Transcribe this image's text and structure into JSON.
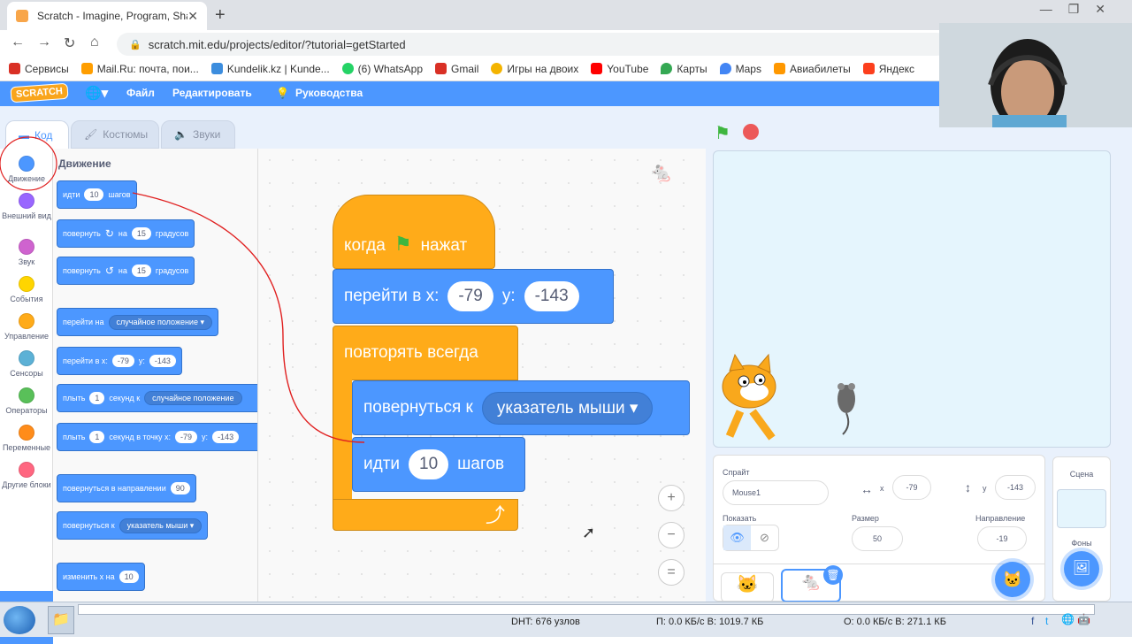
{
  "browser": {
    "tab_title": "Scratch - Imagine, Program, Sha",
    "new_tab": "+",
    "url": "scratch.mit.edu/projects/editor/?tutorial=getStarted",
    "bookmarks": [
      {
        "label": "Сервисы",
        "color": "#d93025"
      },
      {
        "label": "Mail.Ru: почта, пои...",
        "color": "#ff9e00"
      },
      {
        "label": "Kundelik.kz | Kunde...",
        "color": "#3c8dde"
      },
      {
        "label": "(6) WhatsApp",
        "color": "#25d366"
      },
      {
        "label": "Gmail",
        "color": "#d93025"
      },
      {
        "label": "Игры на двоих",
        "color": "#f4b400"
      },
      {
        "label": "YouTube",
        "color": "#ff0000"
      },
      {
        "label": "Карты",
        "color": "#34a853"
      },
      {
        "label": "Maps",
        "color": "#4285f4"
      },
      {
        "label": "Авиабилеты",
        "color": "#ff9800"
      },
      {
        "label": "Яндекс",
        "color": "#fc3f1d"
      }
    ]
  },
  "menu": {
    "logo": "SCRATCH",
    "file": "Файл",
    "edit": "Редактировать",
    "tutorials": "Руководства"
  },
  "editor_tabs": {
    "code": "Код",
    "costumes": "Костюмы",
    "sounds": "Звуки"
  },
  "categories": [
    {
      "label": "Движение",
      "color": "#4c97ff"
    },
    {
      "label": "Внешний вид",
      "color": "#9966ff"
    },
    {
      "label": "Звук",
      "color": "#cf63cf"
    },
    {
      "label": "События",
      "color": "#ffd500"
    },
    {
      "label": "Управление",
      "color": "#ffab19"
    },
    {
      "label": "Сенсоры",
      "color": "#5cb1d6"
    },
    {
      "label": "Операторы",
      "color": "#59c059"
    },
    {
      "label": "Переменные",
      "color": "#ff8c1a"
    },
    {
      "label": "Другие блоки",
      "color": "#ff6680"
    }
  ],
  "palette": {
    "title": "Движение",
    "b1": {
      "a": "идти",
      "v": "10",
      "b": "шагов"
    },
    "b2": {
      "a": "повернуть",
      "b": "на",
      "v": "15",
      "c": "градусов"
    },
    "b3": {
      "a": "повернуть",
      "b": "на",
      "v": "15",
      "c": "градусов"
    },
    "b4": {
      "a": "перейти на",
      "d": "случайное положение"
    },
    "b5": {
      "a": "перейти в x:",
      "v1": "-79",
      "b": "y:",
      "v2": "-143"
    },
    "b6": {
      "a": "плыть",
      "v": "1",
      "b": "секунд к",
      "d": "случайное положение"
    },
    "b7": {
      "a": "плыть",
      "v": "1",
      "b": "секунд в точку x:",
      "v1": "-79",
      "c": "y:",
      "v2": "-143"
    },
    "b8": {
      "a": "повернуться в направлении",
      "v": "90"
    },
    "b9": {
      "a": "повернуться к",
      "d": "указатель мыши"
    },
    "b10": {
      "a": "изменить х на",
      "v": "10"
    }
  },
  "script": {
    "hat_when": "когда",
    "hat_clicked": "нажат",
    "goto_label": "перейти в x:",
    "goto_x": "-79",
    "goto_y_label": "y:",
    "goto_y": "-143",
    "forever": "повторять всегда",
    "point_label": "повернуться к",
    "point_target": "указатель мыши",
    "move_label": "идти",
    "move_steps": "10",
    "move_suffix": "шагов"
  },
  "sprite_info": {
    "sprite_label": "Спрайт",
    "sprite_name": "Mouse1",
    "x_label": "x",
    "x": "-79",
    "y_label": "y",
    "y": "-143",
    "show_label": "Показать",
    "size_label": "Размер",
    "size": "50",
    "direction_label": "Направление",
    "direction": "-19"
  },
  "scene": {
    "title": "Сцена",
    "backdrops": "Фоны"
  },
  "taskbar": {
    "dht": "DHT: 676 узлов",
    "down": "П: 0.0 КБ/с В: 1019.7 КБ",
    "up": "О: 0.0 КБ/с В: 271.1 КБ"
  }
}
